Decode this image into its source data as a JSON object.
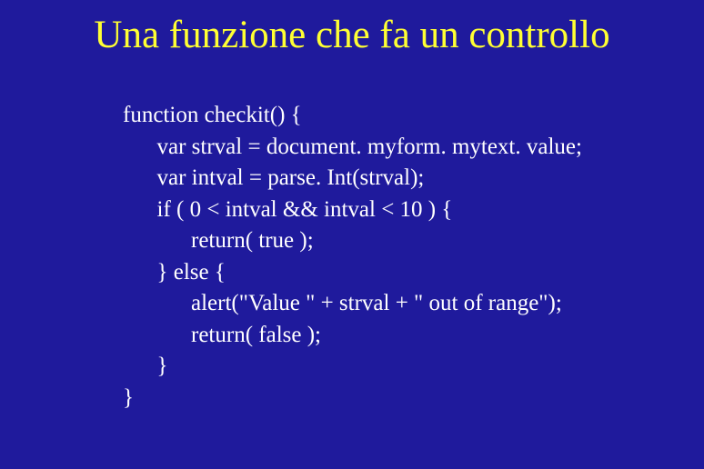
{
  "title": "Una funzione che fa un controllo",
  "code": {
    "l1": "function checkit() {",
    "l2": "      var strval = document. myform. mytext. value;",
    "l3": "      var intval = parse. Int(strval);",
    "l4": "      if ( 0 < intval && intval < 10 ) {",
    "l5": "            return( true );",
    "l6": "      } else {",
    "l7": "            alert(\"Value \" + strval + \" out of range\");",
    "l8": "            return( false );",
    "l9": "      }",
    "l10": "}"
  }
}
